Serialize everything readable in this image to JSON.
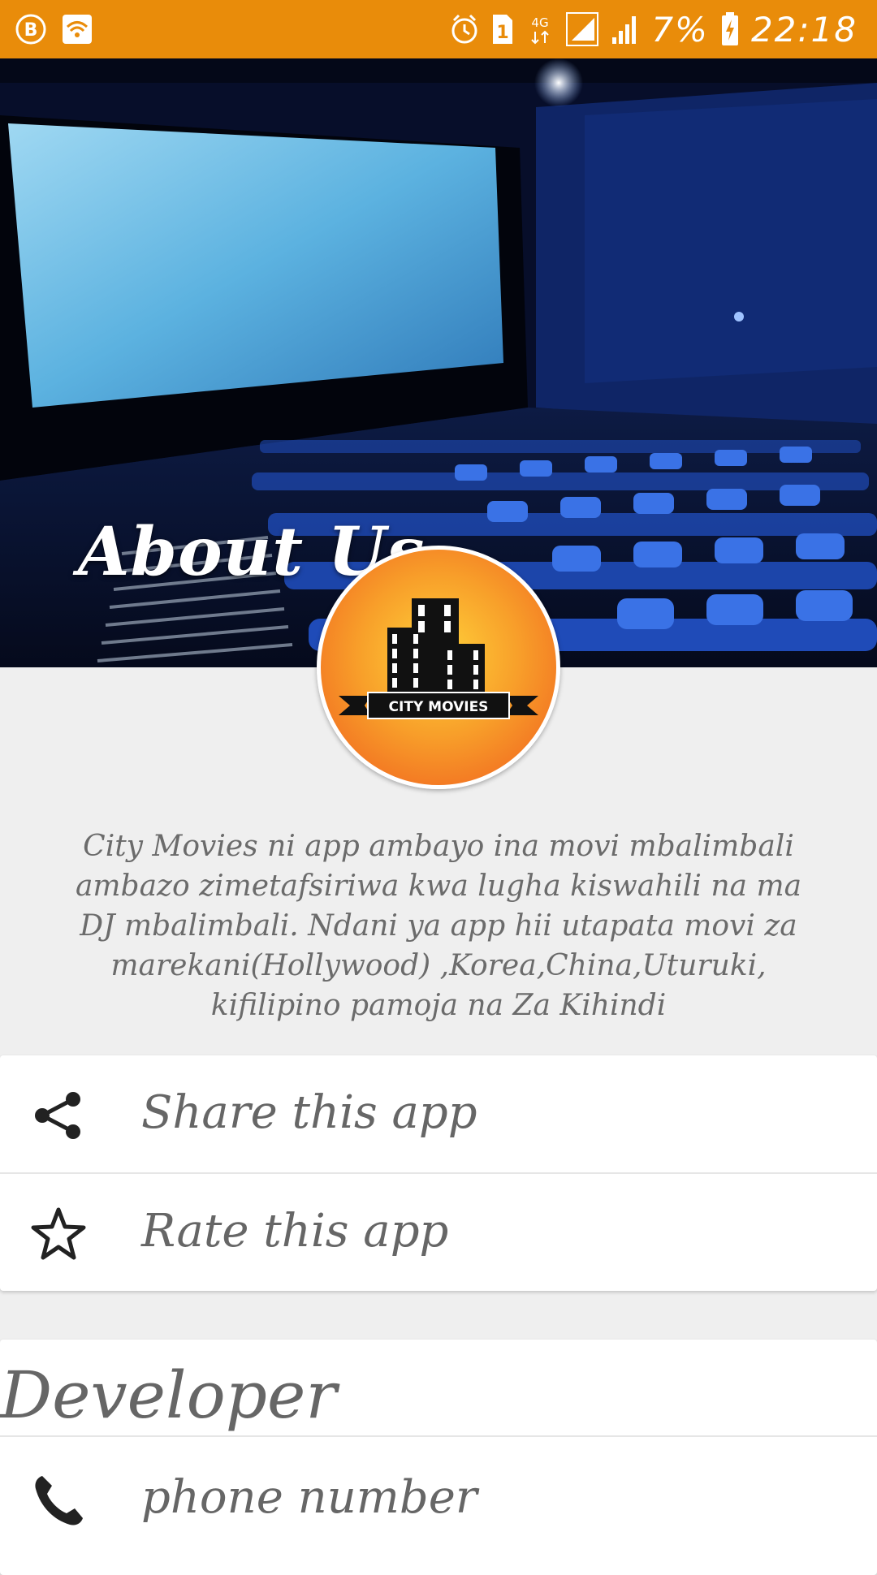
{
  "status_bar": {
    "battery": "7%",
    "time": "22:18",
    "sim_slot": "1",
    "network": "4G",
    "icons": [
      "bbm-icon",
      "wifi-icon",
      "alarm-icon",
      "sim-icon",
      "network-icon",
      "signal-icon",
      "battery-icon"
    ]
  },
  "hero": {
    "title": "About Us"
  },
  "logo": {
    "text": "CITY MOVIES"
  },
  "description": "City Movies ni app ambayo ina movi mbalimbali ambazo zimetafsiriwa kwa lugha kiswahili na ma DJ mbalimbali. Ndani ya app hii utapata movi za marekani(Hollywood) ,Korea,China,Uturuki, kifilipino pamoja na Za Kihindi",
  "actions": [
    {
      "label": "Share this app",
      "icon": "share-icon"
    },
    {
      "label": "Rate this app",
      "icon": "star-icon"
    }
  ],
  "developer": {
    "title": "Developer",
    "phone_label": "phone number",
    "phone_icon": "phone-icon"
  },
  "colors": {
    "status_bar": "#e98c0a",
    "background": "#efefef",
    "text": "#666666"
  }
}
